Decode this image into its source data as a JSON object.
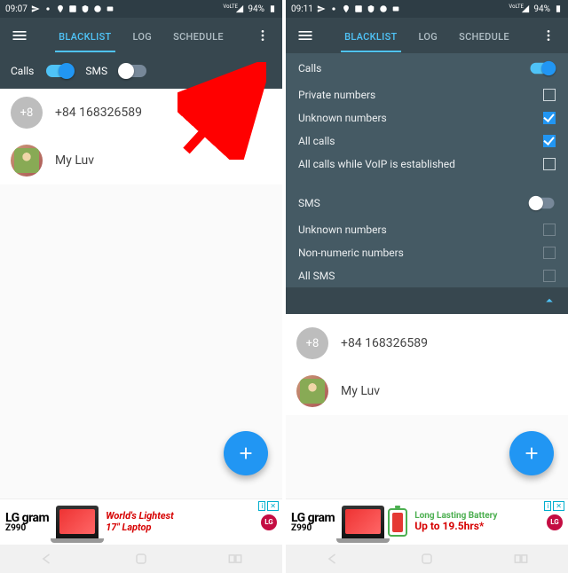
{
  "left": {
    "status": {
      "time": "09:07",
      "battery": "94%"
    },
    "tabs": {
      "blacklist": "BLACKLIST",
      "log": "LOG",
      "schedule": "SCHEDULE"
    },
    "filter": {
      "calls_label": "Calls",
      "calls_on": true,
      "sms_label": "SMS",
      "sms_on": false
    },
    "contacts": [
      {
        "avatar_text": "+8",
        "label": "+84 168326589"
      },
      {
        "avatar_text": "",
        "label": "My Luv",
        "is_image": true
      }
    ],
    "ad": {
      "brand_top": "LG gram",
      "brand_sub": "Z990",
      "line1": "World's Lightest",
      "line2": "17\" Laptop",
      "lg_badge": "LG",
      "ad_info": "i",
      "ad_x": "✕"
    }
  },
  "right": {
    "status": {
      "time": "09:11",
      "battery": "94%"
    },
    "tabs": {
      "blacklist": "BLACKLIST",
      "log": "LOG",
      "schedule": "SCHEDULE"
    },
    "settings": {
      "calls_header": "Calls",
      "calls_on": true,
      "rows_calls": [
        {
          "label": "Private numbers",
          "checked": false
        },
        {
          "label": "Unknown numbers",
          "checked": true
        },
        {
          "label": "All calls",
          "checked": true
        },
        {
          "label": "All calls while VoIP is established",
          "checked": false
        }
      ],
      "sms_header": "SMS",
      "sms_on": false,
      "rows_sms": [
        {
          "label": "Unknown numbers",
          "checked": false,
          "dim": true
        },
        {
          "label": "Non-numeric numbers",
          "checked": false,
          "dim": true
        },
        {
          "label": "All SMS",
          "checked": false,
          "dim": true
        }
      ]
    },
    "contacts": [
      {
        "avatar_text": "+8",
        "label": "+84 168326589"
      },
      {
        "avatar_text": "",
        "label": "My Luv",
        "is_image": true
      }
    ],
    "ad": {
      "brand_top": "LG gram",
      "brand_sub": "Z990",
      "line1": "Long Lasting Battery",
      "line2": "Up to 19.5hrs*",
      "lg_badge": "LG",
      "ad_info": "i",
      "ad_x": "✕"
    }
  }
}
